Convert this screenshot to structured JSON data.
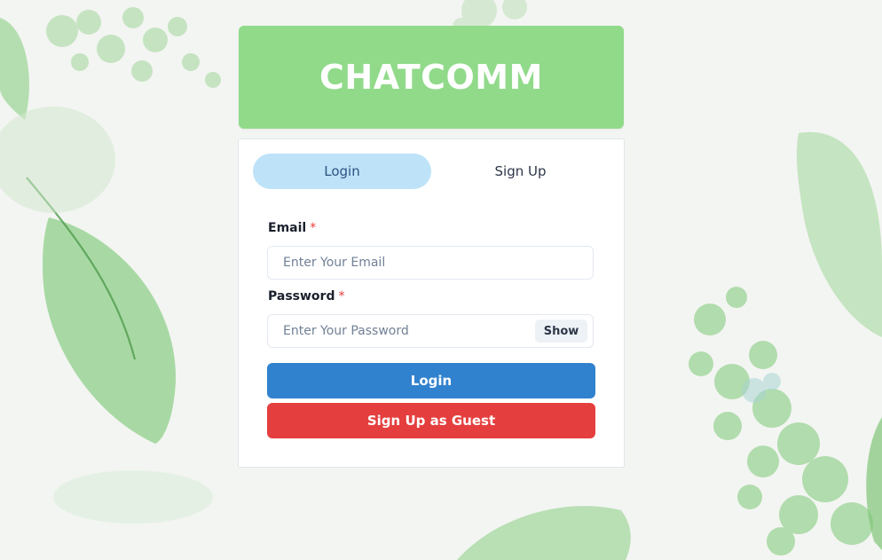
{
  "app": {
    "title": "CHATCOMM"
  },
  "tabs": [
    {
      "label": "Login",
      "selected": true
    },
    {
      "label": "Sign Up",
      "selected": false
    }
  ],
  "form": {
    "email": {
      "label": "Email",
      "required_mark": "*",
      "placeholder": "Enter Your Email",
      "value": ""
    },
    "password": {
      "label": "Password",
      "required_mark": "*",
      "placeholder": "Enter Your Password",
      "value": "",
      "toggle_label": "Show"
    }
  },
  "buttons": {
    "login_label": "Login",
    "guest_label": "Sign Up as Guest"
  },
  "colors": {
    "header_bg": "#90da8a",
    "tab_selected_bg": "#bee3f8",
    "login_button": "#3182ce",
    "guest_button": "#e53e3e",
    "required_mark": "#e53e3e"
  }
}
